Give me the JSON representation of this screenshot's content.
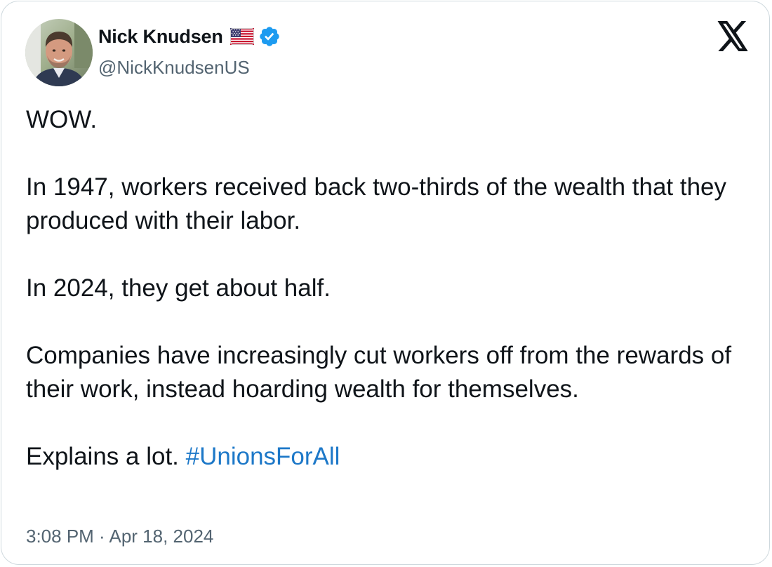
{
  "author": {
    "display_name": "Nick Knudsen",
    "handle": "@NickKnudsenUS",
    "flag_icon": "us-flag-icon",
    "verified_icon": "verified-badge-icon"
  },
  "platform": {
    "logo_icon": "x-logo-icon"
  },
  "tweet": {
    "paragraphs": [
      "WOW.",
      "In 1947, workers received back two-thirds of the wealth that they produced with their labor.",
      "In 2024, they get about half.",
      "Companies have increasingly cut workers off from the rewards of their work, instead hoarding wealth for themselves."
    ],
    "final_text": "Explains a lot. ",
    "hashtag": "#UnionsForAll",
    "timestamp": "3:08 PM · Apr 18, 2024"
  },
  "colors": {
    "text": "#0f1419",
    "secondary_text": "#536471",
    "hashtag": "#1d78c8",
    "verified": "#1d9bf0",
    "border": "#cfd9de"
  }
}
